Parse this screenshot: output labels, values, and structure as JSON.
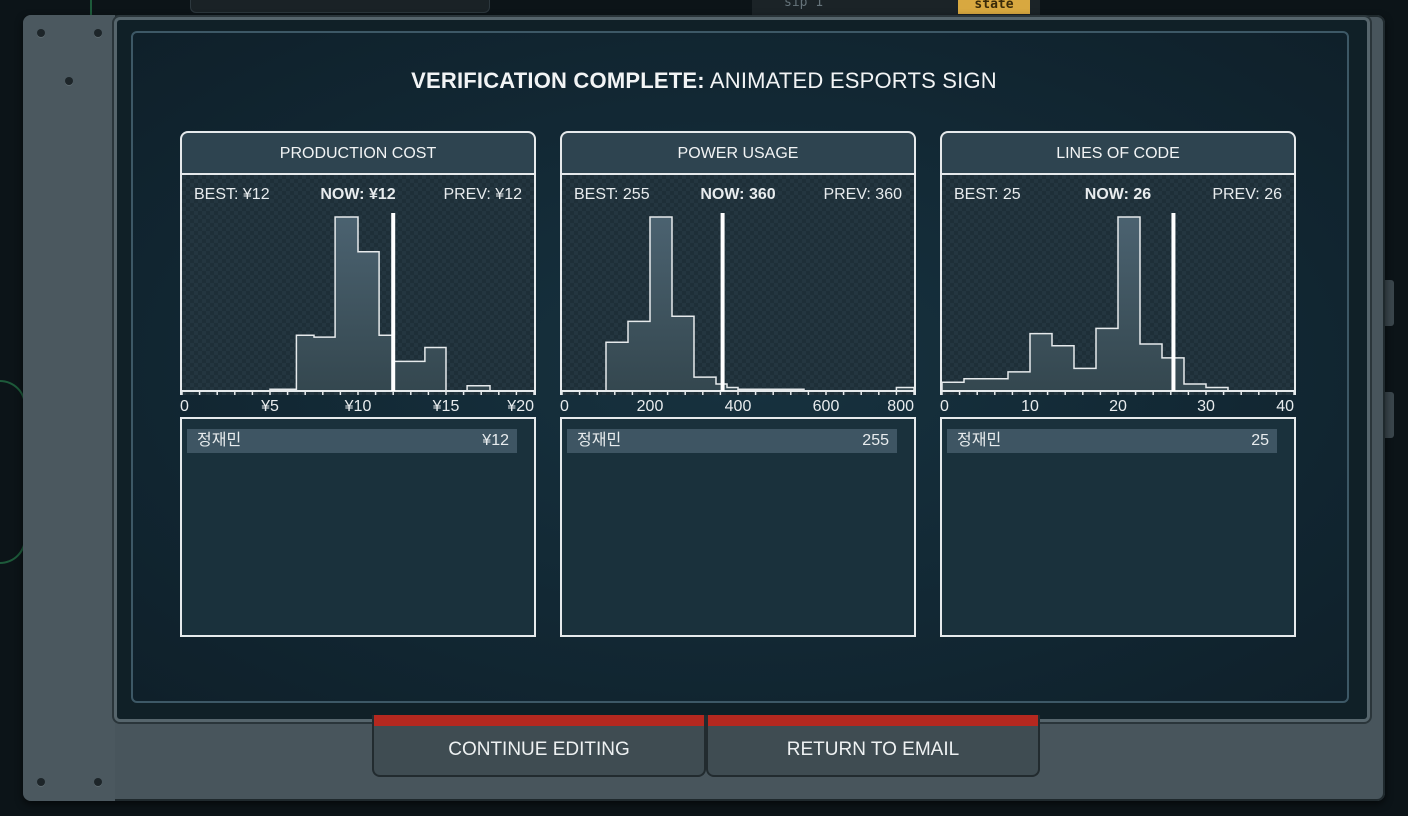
{
  "background": {
    "code_text": "sip 1",
    "state_tag": "state"
  },
  "title": {
    "bold": "VERIFICATION COMPLETE:",
    "rest": "ANIMATED ESPORTS SIGN"
  },
  "metrics": [
    {
      "header": "PRODUCTION COST",
      "best": "BEST: ¥12",
      "now": "NOW: ¥12",
      "prev": "PREV: ¥12",
      "axis_ticks": [
        "0",
        "¥5",
        "¥10",
        "¥15",
        "¥20"
      ],
      "x_range": [
        0,
        20
      ],
      "now_value": 12,
      "histogram": [
        [
          0,
          0
        ],
        [
          1,
          0
        ],
        [
          2,
          0
        ],
        [
          3,
          0
        ],
        [
          4,
          0
        ],
        [
          5,
          1
        ],
        [
          6,
          1
        ],
        [
          6.5,
          32
        ],
        [
          7.5,
          31
        ],
        [
          8.7,
          100
        ],
        [
          10,
          80
        ],
        [
          11.2,
          32
        ],
        [
          12,
          17
        ],
        [
          13.8,
          25
        ],
        [
          15,
          0
        ],
        [
          16,
          0
        ],
        [
          16.2,
          3
        ],
        [
          17.5,
          0
        ],
        [
          20,
          0
        ]
      ],
      "leaderboard": [
        {
          "name": "정재민",
          "value": "¥12"
        }
      ]
    },
    {
      "header": "POWER USAGE",
      "best": "BEST: 255",
      "now": "NOW: 360",
      "prev": "PREV: 360",
      "axis_ticks": [
        "0",
        "200",
        "400",
        "600",
        "800"
      ],
      "x_range": [
        0,
        800
      ],
      "now_value": 365,
      "histogram": [
        [
          0,
          0
        ],
        [
          100,
          28
        ],
        [
          150,
          40
        ],
        [
          200,
          100
        ],
        [
          250,
          43
        ],
        [
          300,
          8
        ],
        [
          350,
          4
        ],
        [
          375,
          2
        ],
        [
          400,
          1
        ],
        [
          550,
          0
        ],
        [
          740,
          0
        ],
        [
          760,
          2
        ],
        [
          800,
          2
        ]
      ],
      "leaderboard": [
        {
          "name": "정재민",
          "value": "255"
        }
      ]
    },
    {
      "header": "LINES OF CODE",
      "best": "BEST: 25",
      "now": "NOW: 26",
      "prev": "PREV: 26",
      "axis_ticks": [
        "0",
        "10",
        "20",
        "30",
        "40"
      ],
      "x_range": [
        0,
        40
      ],
      "now_value": 26.3,
      "histogram": [
        [
          0,
          5
        ],
        [
          2.5,
          7
        ],
        [
          7.5,
          11
        ],
        [
          10,
          33
        ],
        [
          12.5,
          26
        ],
        [
          15,
          13
        ],
        [
          17.5,
          36
        ],
        [
          20,
          100
        ],
        [
          22.5,
          27
        ],
        [
          25,
          19
        ],
        [
          27.5,
          4
        ],
        [
          30,
          2
        ],
        [
          32.5,
          0
        ],
        [
          40,
          0
        ]
      ],
      "leaderboard": [
        {
          "name": "정재민",
          "value": "25"
        }
      ]
    }
  ],
  "buttons": {
    "continue": "CONTINUE EDITING",
    "return": "RETURN TO EMAIL"
  }
}
